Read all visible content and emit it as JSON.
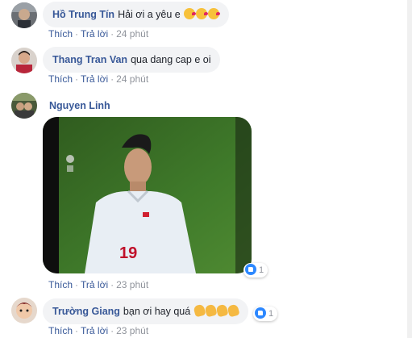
{
  "colors": {
    "author_link": "#385898",
    "bubble_bg": "#f2f3f5",
    "meta_gray": "#90949c",
    "like_blue": "#2d88ff"
  },
  "comments": [
    {
      "author": "Hồ Trung Tín",
      "text": "Hải ơi a yêu e",
      "emojis": [
        "kiss-emoji",
        "kiss-emoji",
        "kiss-emoji"
      ],
      "actions": {
        "like": "Thích",
        "reply": "Trả lời",
        "time": "24 phút"
      }
    },
    {
      "author": "Thang Tran Van",
      "text": "qua dang cap e oi",
      "actions": {
        "like": "Thích",
        "reply": "Trả lời",
        "time": "24 phút"
      }
    },
    {
      "author": "Nguyen Linh",
      "media": "video-still-player-19",
      "reactions": {
        "icon": "like-icon",
        "count": "1"
      },
      "actions": {
        "like": "Thích",
        "reply": "Trả lời",
        "time": "23 phút"
      }
    },
    {
      "author": "Trường Giang",
      "text": "bạn ơi hay quá",
      "emojis": [
        "clap-emoji",
        "clap-emoji",
        "clap-emoji",
        "clap-emoji"
      ],
      "reactions": {
        "icon": "like-icon",
        "count": "1"
      },
      "actions": {
        "like": "Thích",
        "reply": "Trả lời",
        "time": "23 phút"
      }
    }
  ],
  "separator": "·"
}
